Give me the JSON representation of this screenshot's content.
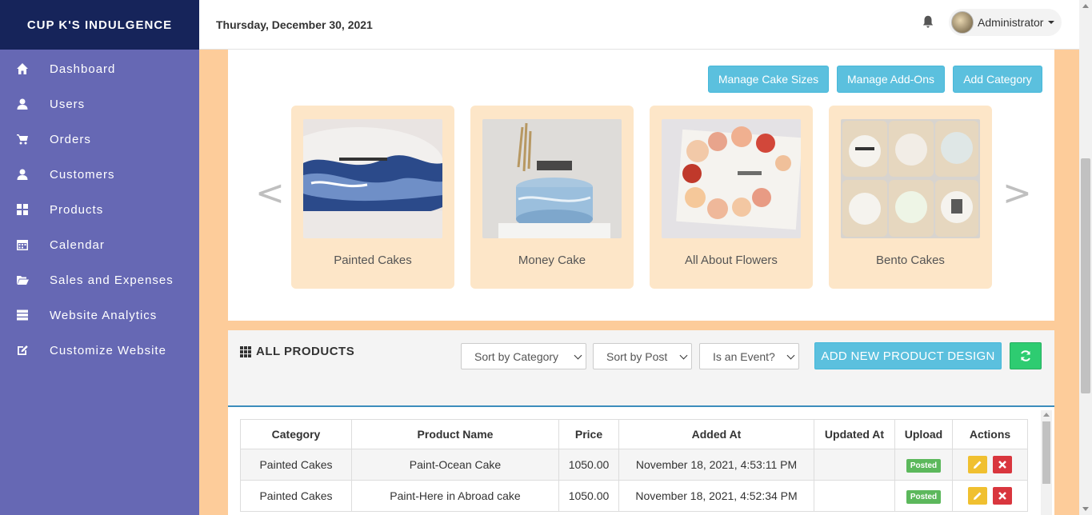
{
  "brand": "CUP K'S INDULGENCE",
  "sidebar": {
    "items": [
      {
        "label": "Dashboard",
        "icon": "home-icon"
      },
      {
        "label": "Users",
        "icon": "user-icon"
      },
      {
        "label": "Orders",
        "icon": "cart-icon"
      },
      {
        "label": "Customers",
        "icon": "user-icon"
      },
      {
        "label": "Products",
        "icon": "grid-icon"
      },
      {
        "label": "Calendar",
        "icon": "calendar-icon"
      },
      {
        "label": "Sales and Expenses",
        "icon": "folder-open-icon"
      },
      {
        "label": "Website Analytics",
        "icon": "server-icon"
      },
      {
        "label": "Customize Website",
        "icon": "edit-icon"
      }
    ]
  },
  "header": {
    "date": "Thursday, December 30, 2021",
    "user": "Administrator"
  },
  "categories": {
    "buttons": {
      "sizes": "Manage Cake Sizes",
      "addons": "Manage Add-Ons",
      "add": "Add Category"
    },
    "prev": "<",
    "next": ">",
    "cards": [
      {
        "name": "Painted Cakes"
      },
      {
        "name": "Money Cake"
      },
      {
        "name": "All About Flowers"
      },
      {
        "name": "Bento Cakes"
      }
    ]
  },
  "products": {
    "title": "ALL PRODUCTS",
    "filters": {
      "category": "Sort by Category",
      "post": "Sort by Post",
      "event": "Is an Event?"
    },
    "add_button": "ADD NEW PRODUCT DESIGN",
    "columns": [
      "Category",
      "Product Name",
      "Price",
      "Added At",
      "Updated At",
      "Upload",
      "Actions"
    ],
    "rows": [
      {
        "category": "Painted Cakes",
        "name": "Paint-Ocean Cake",
        "price": "1050.00",
        "added": "November 18, 2021, 4:53:11 PM",
        "updated": "",
        "upload": "Posted"
      },
      {
        "category": "Painted Cakes",
        "name": "Paint-Here in Abroad cake",
        "price": "1050.00",
        "added": "November 18, 2021, 4:52:34 PM",
        "updated": "",
        "upload": "Posted"
      }
    ]
  },
  "colors": {
    "sidebar": "#6668b4",
    "brand_bar": "#16245a",
    "background": "#fdcc9a",
    "info_button": "#5bc0de",
    "card": "#fde6c8",
    "posted_badge": "#5cb85c",
    "refresh_button": "#2ecc71"
  }
}
